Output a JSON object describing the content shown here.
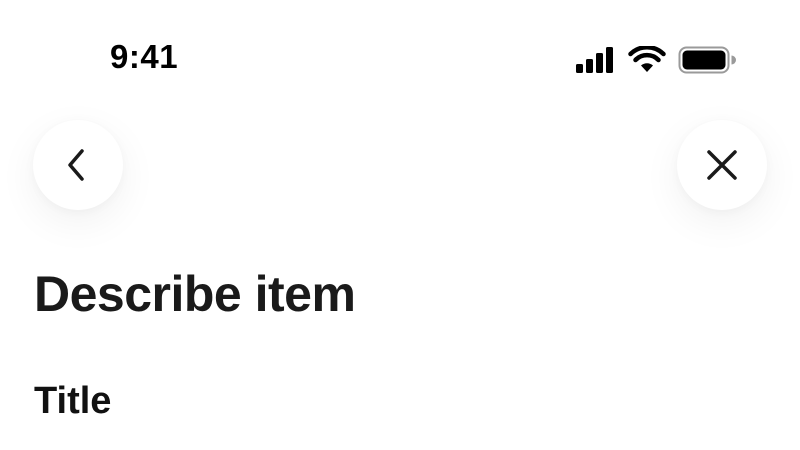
{
  "status_bar": {
    "time": "9:41",
    "icons": [
      "signal-icon",
      "wifi-icon",
      "battery-icon"
    ]
  },
  "navigation": {
    "back_icon": "chevron-left-icon",
    "close_icon": "close-icon"
  },
  "header": {
    "title": "Describe item"
  },
  "form": {
    "title_label": "Title"
  },
  "colors": {
    "text": "#111111",
    "background": "#ffffff"
  }
}
